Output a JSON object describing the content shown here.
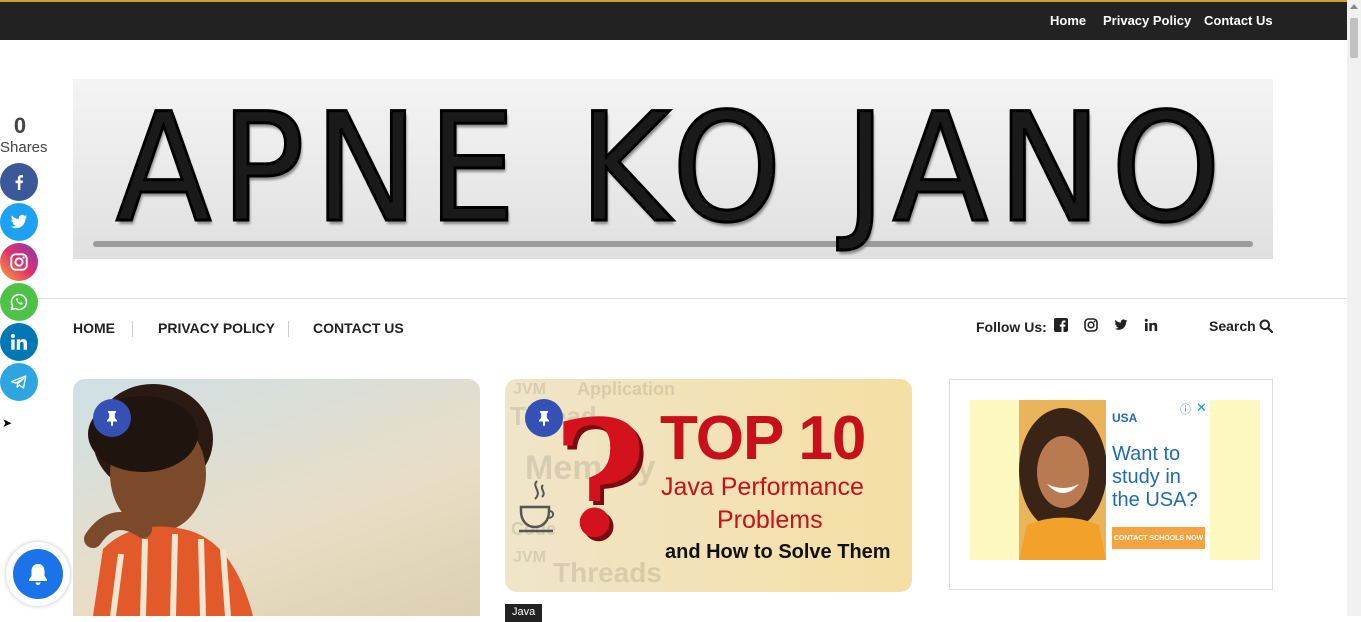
{
  "topbar": {
    "links": [
      "Home",
      "Privacy Policy",
      "Contact Us"
    ]
  },
  "banner": {
    "logo_text": "APNE KO JANO"
  },
  "nav": {
    "items": [
      "HOME",
      "PRIVACY POLICY",
      "CONTACT US"
    ],
    "follow_label": "Follow Us:",
    "search_label": "Search"
  },
  "social_share": {
    "count": "0",
    "label": "Shares",
    "buttons": [
      {
        "name": "facebook",
        "color": "#3b5998"
      },
      {
        "name": "twitter",
        "color": "#1da1f2"
      },
      {
        "name": "instagram",
        "color": "#c13584"
      },
      {
        "name": "whatsapp",
        "color": "#4dc247"
      },
      {
        "name": "linkedin",
        "color": "#0077b5"
      },
      {
        "name": "telegram",
        "color": "#2ca5e0"
      }
    ]
  },
  "posts": [
    {
      "image": "boy-thinking-illustration",
      "pinned": true
    },
    {
      "image": "top-10-java-performance",
      "pinned": true,
      "overlay_title": "TOP 10",
      "overlay_line1": "Java Performance",
      "overlay_line2": "Problems",
      "overlay_line3": "and How to Solve Them",
      "bg_words": [
        "JVM",
        "Application",
        "Thread",
        "Memory",
        "Code",
        "JVM",
        "Threads"
      ],
      "tag": "Java"
    }
  ],
  "ad": {
    "brand": "USA",
    "headline": "Want to study in the USA?",
    "cta": "CONTACT SCHOOLS NOW",
    "info_icon": "ⓘ",
    "close_icon": "✕"
  },
  "colors": {
    "topbar_bg": "#222222",
    "accent_blue": "#3551b5",
    "notification_blue": "#1a73e8"
  }
}
